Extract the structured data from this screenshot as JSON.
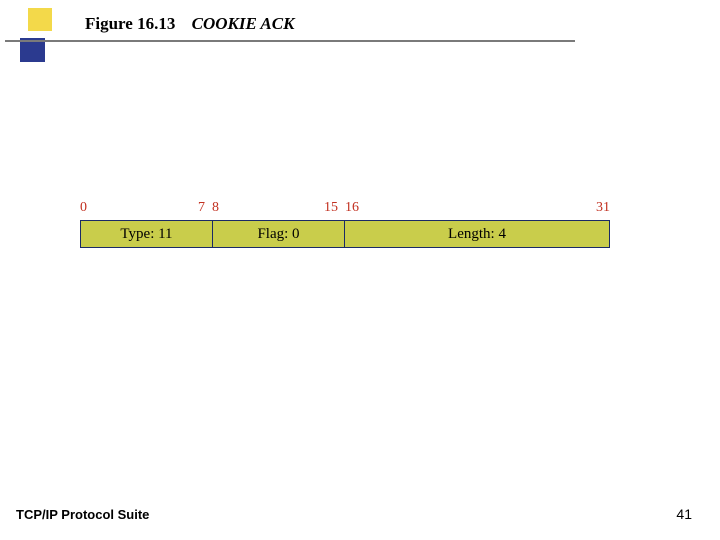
{
  "header": {
    "figure_number": "Figure 16.13",
    "figure_title": "COOKIE ACK"
  },
  "bit_labels": {
    "b0": "0",
    "b7": "7",
    "b8": "8",
    "b15": "15",
    "b16": "16",
    "b31": "31"
  },
  "fields": {
    "type": "Type: 11",
    "flag": "Flag: 0",
    "length": "Length: 4"
  },
  "footer": {
    "suite": "TCP/IP Protocol Suite",
    "page": "41"
  },
  "chart_data": {
    "type": "table",
    "title": "COOKIE ACK chunk format (32-bit word)",
    "bit_range": [
      0,
      31
    ],
    "fields": [
      {
        "name": "Type",
        "bits": "0-7",
        "width_bits": 8,
        "value": 11
      },
      {
        "name": "Flag",
        "bits": "8-15",
        "width_bits": 8,
        "value": 0
      },
      {
        "name": "Length",
        "bits": "16-31",
        "width_bits": 16,
        "value": 4
      }
    ]
  }
}
